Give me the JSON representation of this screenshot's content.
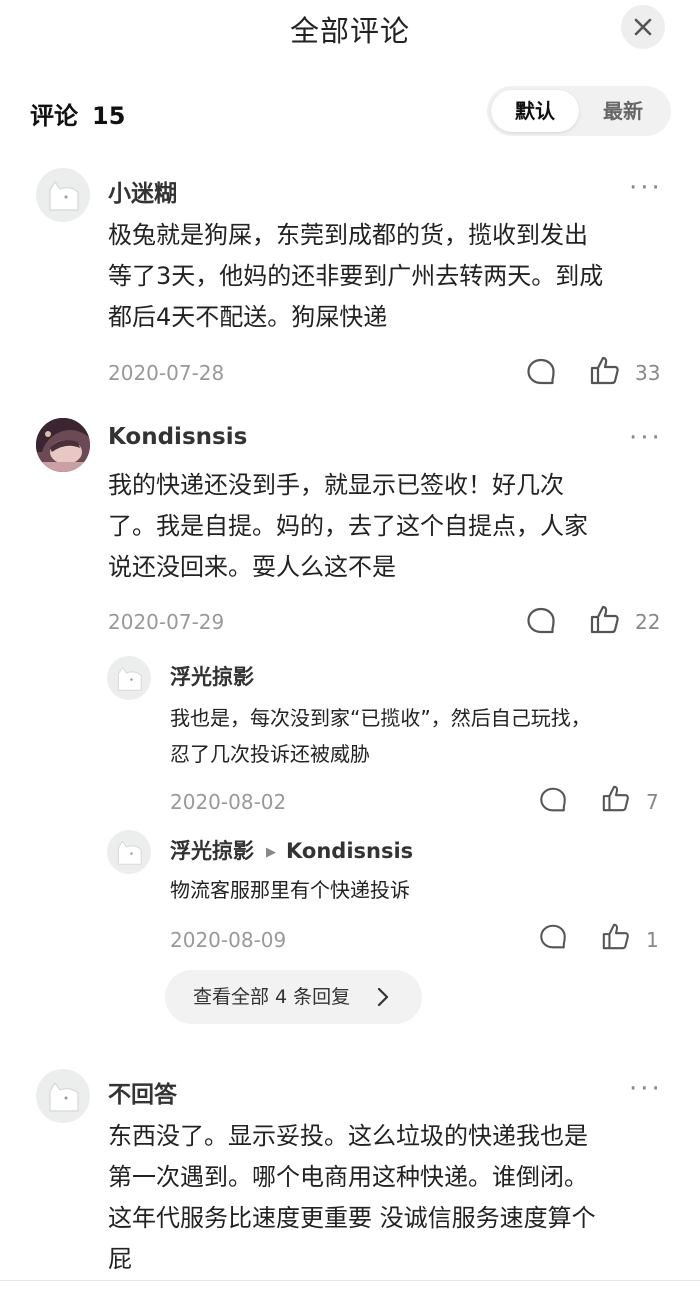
{
  "header": {
    "title": "全部评论",
    "close_icon": "close-icon"
  },
  "comments_bar": {
    "label": "评论",
    "count": "15"
  },
  "sort": {
    "default_label": "默认",
    "latest_label": "最新",
    "selected": "默认"
  },
  "comments": [
    {
      "name": "小迷糊",
      "text": [
        "极兔就是狗屎，东莞到成都的货，揽收到发出",
        "等了3天，他妈的还非要到广州去转两天。到成",
        "都后4天不配送。狗屎快递"
      ],
      "date": "2020-07-28",
      "likes": "33"
    },
    {
      "name": "Kondisnsis",
      "text": [
        "我的快递还没到手，就显示已签收！好几次",
        "了。我是自提。妈的，去了这个自提点，人家",
        "说还没回来。耍人么这不是"
      ],
      "date": "2020-07-29",
      "likes": "22",
      "replies": [
        {
          "name": "浮光掠影",
          "text": [
            "我也是，每次没到家“已揽收”，然后自己玩找，",
            "忍了几次投诉还被威胁"
          ],
          "date": "2020-08-02",
          "likes": "7"
        },
        {
          "name": "浮光掠影",
          "reply_to": "Kondisnsis",
          "text": [
            "物流客服那里有个快递投诉"
          ],
          "date": "2020-08-09",
          "likes": "1"
        }
      ],
      "view_all_replies": "查看全部 4 条回复"
    },
    {
      "name": "不回答",
      "text": [
        "东西没了。显示妥投。这么垃圾的快递我也是",
        "第一次遇到。哪个电商用这种快递。谁倒闭。",
        "这年代服务比速度更重要 没诚信服务速度算个",
        "屁"
      ]
    }
  ],
  "more_label": "···"
}
